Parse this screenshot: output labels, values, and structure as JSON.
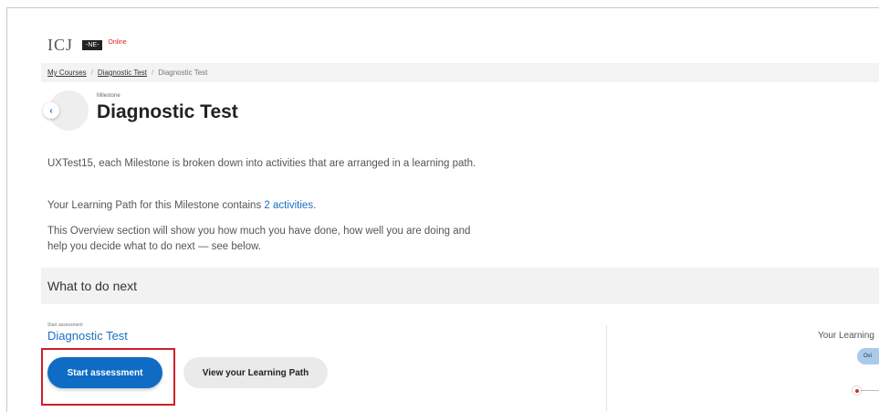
{
  "header": {
    "logo_mark": "ICJ",
    "logo_badge": "-NE-",
    "logo_tag": "Online"
  },
  "breadcrumb": {
    "items": [
      {
        "label": "My Courses",
        "link": true
      },
      {
        "label": "Diagnostic Test",
        "link": true
      },
      {
        "label": "Diagnostic Test",
        "link": false
      }
    ],
    "separator": "/"
  },
  "milestone": {
    "back_icon": "chevron-left-icon",
    "back_glyph": "‹",
    "label": "Milestone",
    "title": "Diagnostic Test"
  },
  "intro": {
    "p1": "UXTest15, each Milestone is broken down into activities that are arranged in a learning path.",
    "p2_before": "Your Learning Path for this Milestone contains ",
    "p2_link": "2 activities",
    "p2_after": ".",
    "p3": "This Overview section will show you how much you have done, how well you are doing and help you decide what to do next — see below."
  },
  "next_section": {
    "heading": "What to do next",
    "start_label": "Start assessment",
    "activity_title": "Diagnostic Test",
    "start_button": "Start assessment",
    "path_button": "View your Learning Path"
  },
  "side_panel": {
    "title": "Your Learning",
    "pill": "Ovi"
  },
  "colors": {
    "accent": "#0f6cc4",
    "highlight": "#d01f26",
    "link": "#1a6fc2"
  }
}
